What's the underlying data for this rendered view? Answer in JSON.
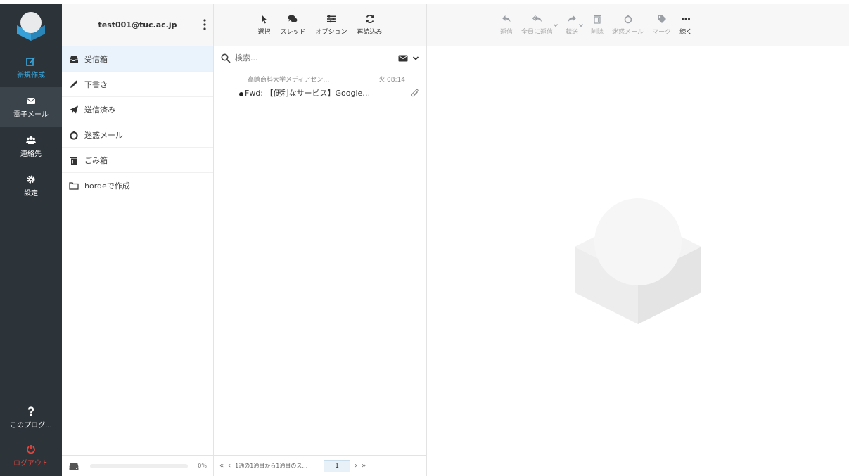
{
  "account": {
    "email": "test001@tuc.ac.jp"
  },
  "nav": {
    "items": [
      {
        "label": "新規作成",
        "icon": "compose-icon"
      },
      {
        "label": "電子メール",
        "icon": "envelope-icon"
      },
      {
        "label": "連絡先",
        "icon": "users-icon"
      },
      {
        "label": "設定",
        "icon": "gear-icon"
      },
      {
        "label": "このプログ…",
        "icon": "question-icon"
      },
      {
        "label": "ログアウト",
        "icon": "power-icon"
      }
    ]
  },
  "folders": [
    {
      "label": "受信箱",
      "icon": "inbox-icon"
    },
    {
      "label": "下書き",
      "icon": "pencil-icon"
    },
    {
      "label": "送信済み",
      "icon": "paper-plane-icon"
    },
    {
      "label": "迷惑メール",
      "icon": "fire-icon"
    },
    {
      "label": "ごみ箱",
      "icon": "trash-icon"
    },
    {
      "label": "hordeで作成",
      "icon": "folder-icon"
    }
  ],
  "quota": {
    "percent_label": "0%",
    "used_fraction": 0
  },
  "list_toolbar": {
    "items": [
      {
        "label": "選択",
        "icon": "pointer-icon"
      },
      {
        "label": "スレッド",
        "icon": "comments-icon"
      },
      {
        "label": "オプション",
        "icon": "list-icon"
      },
      {
        "label": "再読込み",
        "icon": "refresh-icon"
      }
    ]
  },
  "search": {
    "placeholder": "検索..."
  },
  "messages": [
    {
      "from": "高崎商科大学メディアセン…",
      "date": "火 08:14",
      "subject": "Fwd: 【便利なサービス】Google…"
    }
  ],
  "pager": {
    "first": "«",
    "prev": "‹",
    "info": "1通の1通目から1通目のス…",
    "page": "1",
    "next": "›",
    "last": "»"
  },
  "preview_toolbar": {
    "items": [
      {
        "label": "返信",
        "icon": "reply-icon"
      },
      {
        "label": "全員に返信",
        "icon": "reply-all-icon"
      },
      {
        "label": "転送",
        "icon": "forward-icon"
      },
      {
        "label": "削除",
        "icon": "trash-icon"
      },
      {
        "label": "迷惑メール",
        "icon": "fire-icon"
      },
      {
        "label": "マーク",
        "icon": "tag-icon"
      },
      {
        "label": "続く",
        "icon": "ellipsis-icon"
      }
    ]
  },
  "colors": {
    "nav_bg": "#2c3339",
    "accent": "#39a9e0",
    "logout": "#e2453d",
    "selected_folder": "#eaf3fb"
  }
}
